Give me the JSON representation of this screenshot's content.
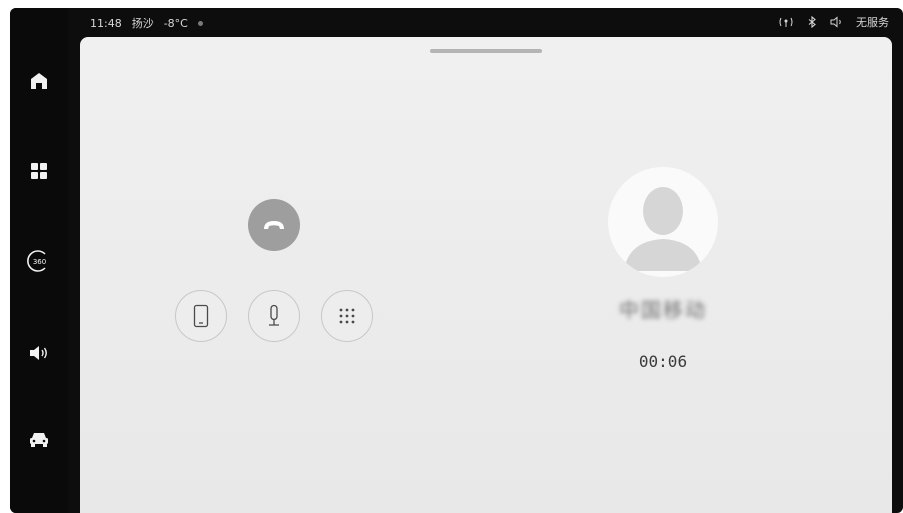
{
  "status_bar": {
    "time": "11:48",
    "weather": "扬沙",
    "temperature": "-8°C",
    "network_status": "无服务"
  },
  "sidebar": {
    "items": [
      {
        "name": "home",
        "icon": "home-icon"
      },
      {
        "name": "apps",
        "icon": "apps-grid-icon"
      },
      {
        "name": "camera-360",
        "icon": "camera-360-icon",
        "label": "360"
      },
      {
        "name": "volume",
        "icon": "volume-icon"
      },
      {
        "name": "vehicle",
        "icon": "car-icon"
      }
    ]
  },
  "call": {
    "caller_name": "中国移动",
    "duration": "00:06",
    "controls": [
      {
        "name": "switch-to-phone",
        "icon": "phone-device-icon"
      },
      {
        "name": "mute-microphone",
        "icon": "microphone-icon"
      },
      {
        "name": "keypad",
        "icon": "keypad-icon"
      }
    ],
    "hangup_icon": "hangup-icon"
  },
  "colors": {
    "panel_bg": "#ececec",
    "hangup_bg": "#9e9e9e",
    "frame_bg": "#0d0d0d"
  }
}
